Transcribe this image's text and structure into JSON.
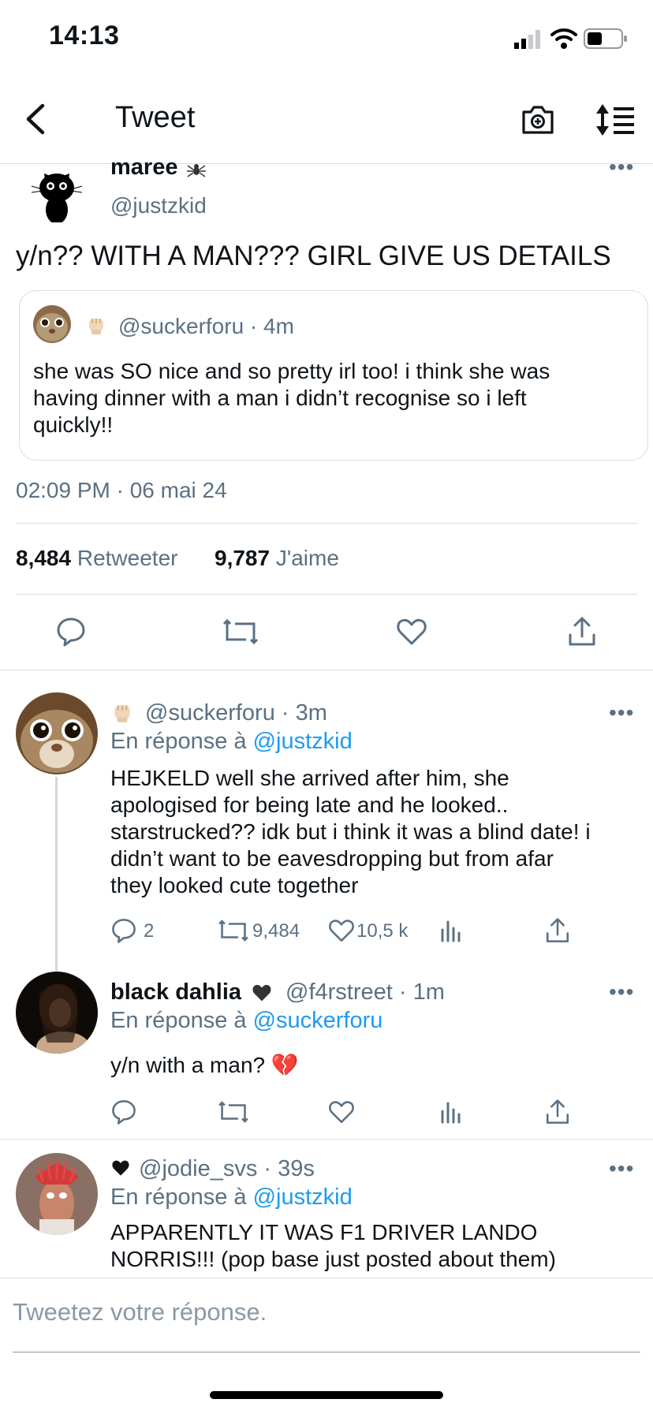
{
  "status_bar": {
    "time": "14:13"
  },
  "nav": {
    "title": "Tweet"
  },
  "main_tweet": {
    "display_name": "maree",
    "handle": "@justzkid",
    "text": "y/n?? WITH A MAN??? GIRL GIVE US DETAILS",
    "quote": {
      "handle_time": "@suckerforu · 4m",
      "text_line1": "she was SO nice and so pretty irl too! i think she was",
      "text_line2": "having dinner with a man i didn’t recognise so i left",
      "text_line3": "quickly!!"
    },
    "timestamp": "02:09 PM · 06 mai 24",
    "retweets_count": "8,484",
    "retweets_label": "Retweeter",
    "likes_count": "9,787",
    "likes_label": "J'aime"
  },
  "replies": [
    {
      "handle_time": "@suckerforu · 3m",
      "reply_prefix": "En réponse à",
      "reply_to": "@justzkid",
      "lines": [
        "HEJKELD well she arrived after him, she",
        "apologised for being late and he looked..",
        "starstrucked?? idk but i think it was a blind date! i",
        "didn’t want to be eavesdropping but from afar",
        "they looked cute together"
      ],
      "reply_count": "2",
      "retweet_count": "9,484",
      "like_count": "10,5 k"
    },
    {
      "display_name": "black dahlia",
      "handle_time": "@f4rstreet · 1m",
      "reply_prefix": "En réponse à",
      "reply_to": "@suckerforu",
      "text": "y/n with a man? 💔"
    },
    {
      "handle_time": "@jodie_svs · 39s",
      "reply_prefix": "En réponse à",
      "reply_to": "@justzkid",
      "lines": [
        "APPARENTLY IT WAS F1 DRIVER LANDO",
        "NORRIS!!! (pop base just posted about them)"
      ]
    }
  ],
  "composer": {
    "placeholder": "Tweetez votre réponse."
  },
  "colors": {
    "accent": "#1d9bf0",
    "muted": "#5b7083",
    "divider": "#d9dde1"
  }
}
